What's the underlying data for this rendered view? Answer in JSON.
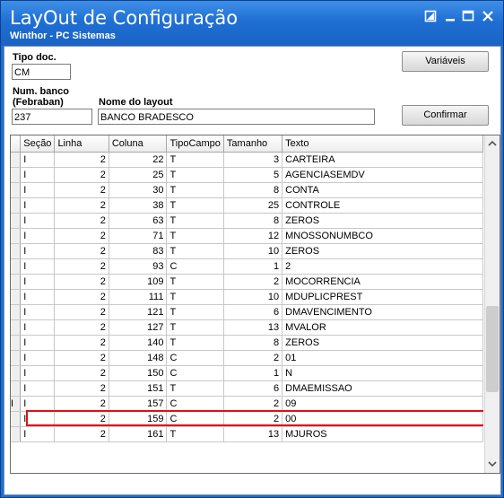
{
  "window": {
    "title": "LayOut de Configuração",
    "subtitle": "Winthor - PC Sistemas",
    "controls": {
      "restore_icon": "restore-icon",
      "minimize_icon": "minimize-icon",
      "maximize_icon": "maximize-icon",
      "close_icon": "close-icon"
    }
  },
  "form": {
    "tipo_doc_label": "Tipo doc.",
    "tipo_doc_value": "CM",
    "num_banco_label_1": "Num. banco",
    "num_banco_label_2": "(Febraban)",
    "num_banco_value": "237",
    "nome_layout_label": "Nome do layout",
    "nome_layout_value": "BANCO BRADESCO",
    "variaveis_button": "Variáveis",
    "confirmar_button": "Confirmar"
  },
  "grid": {
    "columns": [
      "Seção",
      "Linha",
      "Coluna",
      "TipoCampo",
      "Tamanho",
      "Texto"
    ],
    "rows": [
      {
        "indicator": "",
        "secao": "I",
        "linha": "2",
        "coluna": "22",
        "tipo": "T",
        "tamanho": "3",
        "texto": "CARTEIRA"
      },
      {
        "indicator": "",
        "secao": "I",
        "linha": "2",
        "coluna": "25",
        "tipo": "T",
        "tamanho": "5",
        "texto": "AGENCIASEMDV"
      },
      {
        "indicator": "",
        "secao": "I",
        "linha": "2",
        "coluna": "30",
        "tipo": "T",
        "tamanho": "8",
        "texto": "CONTA"
      },
      {
        "indicator": "",
        "secao": "I",
        "linha": "2",
        "coluna": "38",
        "tipo": "T",
        "tamanho": "25",
        "texto": "CONTROLE"
      },
      {
        "indicator": "",
        "secao": "I",
        "linha": "2",
        "coluna": "63",
        "tipo": "T",
        "tamanho": "8",
        "texto": "ZEROS"
      },
      {
        "indicator": "",
        "secao": "I",
        "linha": "2",
        "coluna": "71",
        "tipo": "T",
        "tamanho": "12",
        "texto": "MNOSSONUMBCO"
      },
      {
        "indicator": "",
        "secao": "I",
        "linha": "2",
        "coluna": "83",
        "tipo": "T",
        "tamanho": "10",
        "texto": "ZEROS"
      },
      {
        "indicator": "",
        "secao": "I",
        "linha": "2",
        "coluna": "93",
        "tipo": "C",
        "tamanho": "1",
        "texto": "2"
      },
      {
        "indicator": "",
        "secao": "I",
        "linha": "2",
        "coluna": "109",
        "tipo": "T",
        "tamanho": "2",
        "texto": "MOCORRENCIA"
      },
      {
        "indicator": "",
        "secao": "I",
        "linha": "2",
        "coluna": "111",
        "tipo": "T",
        "tamanho": "10",
        "texto": "MDUPLICPREST"
      },
      {
        "indicator": "",
        "secao": "I",
        "linha": "2",
        "coluna": "121",
        "tipo": "T",
        "tamanho": "6",
        "texto": "DMAVENCIMENTO"
      },
      {
        "indicator": "",
        "secao": "I",
        "linha": "2",
        "coluna": "127",
        "tipo": "T",
        "tamanho": "13",
        "texto": "MVALOR"
      },
      {
        "indicator": "",
        "secao": "I",
        "linha": "2",
        "coluna": "140",
        "tipo": "T",
        "tamanho": "8",
        "texto": "ZEROS"
      },
      {
        "indicator": "",
        "secao": "I",
        "linha": "2",
        "coluna": "148",
        "tipo": "C",
        "tamanho": "2",
        "texto": "01"
      },
      {
        "indicator": "",
        "secao": "I",
        "linha": "2",
        "coluna": "150",
        "tipo": "C",
        "tamanho": "1",
        "texto": "N"
      },
      {
        "indicator": "",
        "secao": "I",
        "linha": "2",
        "coluna": "151",
        "tipo": "T",
        "tamanho": "6",
        "texto": "DMAEMISSAO"
      },
      {
        "indicator": "I",
        "secao": "I",
        "linha": "2",
        "coluna": "157",
        "tipo": "C",
        "tamanho": "2",
        "texto": "09"
      },
      {
        "indicator": "",
        "secao": "I",
        "linha": "2",
        "coluna": "159",
        "tipo": "C",
        "tamanho": "2",
        "texto": "00"
      },
      {
        "indicator": "",
        "secao": "I",
        "linha": "2",
        "coluna": "161",
        "tipo": "T",
        "tamanho": "13",
        "texto": "MJUROS"
      }
    ],
    "highlight_color": "#e01010"
  },
  "colors": {
    "titlebar": "#1f6fd4",
    "frame": "#1d6fd0"
  }
}
